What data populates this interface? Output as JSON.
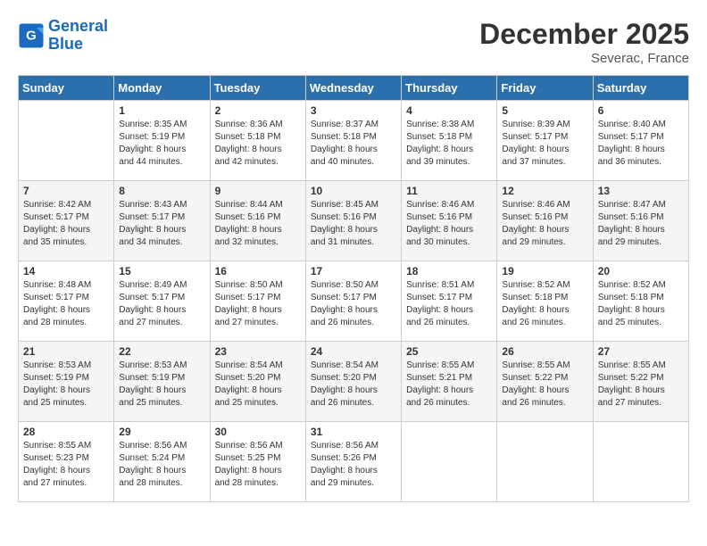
{
  "header": {
    "logo_line1": "General",
    "logo_line2": "Blue",
    "month": "December 2025",
    "location": "Severac, France"
  },
  "weekdays": [
    "Sunday",
    "Monday",
    "Tuesday",
    "Wednesday",
    "Thursday",
    "Friday",
    "Saturday"
  ],
  "weeks": [
    [
      {
        "day": "",
        "text": ""
      },
      {
        "day": "1",
        "text": "Sunrise: 8:35 AM\nSunset: 5:19 PM\nDaylight: 8 hours\nand 44 minutes."
      },
      {
        "day": "2",
        "text": "Sunrise: 8:36 AM\nSunset: 5:18 PM\nDaylight: 8 hours\nand 42 minutes."
      },
      {
        "day": "3",
        "text": "Sunrise: 8:37 AM\nSunset: 5:18 PM\nDaylight: 8 hours\nand 40 minutes."
      },
      {
        "day": "4",
        "text": "Sunrise: 8:38 AM\nSunset: 5:18 PM\nDaylight: 8 hours\nand 39 minutes."
      },
      {
        "day": "5",
        "text": "Sunrise: 8:39 AM\nSunset: 5:17 PM\nDaylight: 8 hours\nand 37 minutes."
      },
      {
        "day": "6",
        "text": "Sunrise: 8:40 AM\nSunset: 5:17 PM\nDaylight: 8 hours\nand 36 minutes."
      }
    ],
    [
      {
        "day": "7",
        "text": "Sunrise: 8:42 AM\nSunset: 5:17 PM\nDaylight: 8 hours\nand 35 minutes."
      },
      {
        "day": "8",
        "text": "Sunrise: 8:43 AM\nSunset: 5:17 PM\nDaylight: 8 hours\nand 34 minutes."
      },
      {
        "day": "9",
        "text": "Sunrise: 8:44 AM\nSunset: 5:16 PM\nDaylight: 8 hours\nand 32 minutes."
      },
      {
        "day": "10",
        "text": "Sunrise: 8:45 AM\nSunset: 5:16 PM\nDaylight: 8 hours\nand 31 minutes."
      },
      {
        "day": "11",
        "text": "Sunrise: 8:46 AM\nSunset: 5:16 PM\nDaylight: 8 hours\nand 30 minutes."
      },
      {
        "day": "12",
        "text": "Sunrise: 8:46 AM\nSunset: 5:16 PM\nDaylight: 8 hours\nand 29 minutes."
      },
      {
        "day": "13",
        "text": "Sunrise: 8:47 AM\nSunset: 5:16 PM\nDaylight: 8 hours\nand 29 minutes."
      }
    ],
    [
      {
        "day": "14",
        "text": "Sunrise: 8:48 AM\nSunset: 5:17 PM\nDaylight: 8 hours\nand 28 minutes."
      },
      {
        "day": "15",
        "text": "Sunrise: 8:49 AM\nSunset: 5:17 PM\nDaylight: 8 hours\nand 27 minutes."
      },
      {
        "day": "16",
        "text": "Sunrise: 8:50 AM\nSunset: 5:17 PM\nDaylight: 8 hours\nand 27 minutes."
      },
      {
        "day": "17",
        "text": "Sunrise: 8:50 AM\nSunset: 5:17 PM\nDaylight: 8 hours\nand 26 minutes."
      },
      {
        "day": "18",
        "text": "Sunrise: 8:51 AM\nSunset: 5:17 PM\nDaylight: 8 hours\nand 26 minutes."
      },
      {
        "day": "19",
        "text": "Sunrise: 8:52 AM\nSunset: 5:18 PM\nDaylight: 8 hours\nand 26 minutes."
      },
      {
        "day": "20",
        "text": "Sunrise: 8:52 AM\nSunset: 5:18 PM\nDaylight: 8 hours\nand 25 minutes."
      }
    ],
    [
      {
        "day": "21",
        "text": "Sunrise: 8:53 AM\nSunset: 5:19 PM\nDaylight: 8 hours\nand 25 minutes."
      },
      {
        "day": "22",
        "text": "Sunrise: 8:53 AM\nSunset: 5:19 PM\nDaylight: 8 hours\nand 25 minutes."
      },
      {
        "day": "23",
        "text": "Sunrise: 8:54 AM\nSunset: 5:20 PM\nDaylight: 8 hours\nand 25 minutes."
      },
      {
        "day": "24",
        "text": "Sunrise: 8:54 AM\nSunset: 5:20 PM\nDaylight: 8 hours\nand 26 minutes."
      },
      {
        "day": "25",
        "text": "Sunrise: 8:55 AM\nSunset: 5:21 PM\nDaylight: 8 hours\nand 26 minutes."
      },
      {
        "day": "26",
        "text": "Sunrise: 8:55 AM\nSunset: 5:22 PM\nDaylight: 8 hours\nand 26 minutes."
      },
      {
        "day": "27",
        "text": "Sunrise: 8:55 AM\nSunset: 5:22 PM\nDaylight: 8 hours\nand 27 minutes."
      }
    ],
    [
      {
        "day": "28",
        "text": "Sunrise: 8:55 AM\nSunset: 5:23 PM\nDaylight: 8 hours\nand 27 minutes."
      },
      {
        "day": "29",
        "text": "Sunrise: 8:56 AM\nSunset: 5:24 PM\nDaylight: 8 hours\nand 28 minutes."
      },
      {
        "day": "30",
        "text": "Sunrise: 8:56 AM\nSunset: 5:25 PM\nDaylight: 8 hours\nand 28 minutes."
      },
      {
        "day": "31",
        "text": "Sunrise: 8:56 AM\nSunset: 5:26 PM\nDaylight: 8 hours\nand 29 minutes."
      },
      {
        "day": "",
        "text": ""
      },
      {
        "day": "",
        "text": ""
      },
      {
        "day": "",
        "text": ""
      }
    ]
  ]
}
